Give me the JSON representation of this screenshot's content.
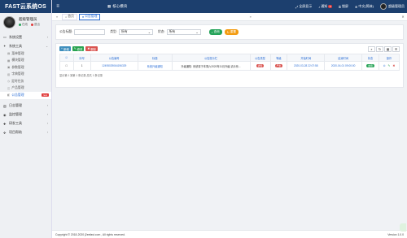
{
  "brand": "FAST云系统OS",
  "user": {
    "name": "超级管理员",
    "status_online": "在线",
    "status_logout": "退出"
  },
  "sidebar": {
    "items": [
      {
        "label": "系统设置",
        "icon": "monitor-icon"
      },
      {
        "label": "系统工具",
        "icon": "tools-icon",
        "expanded": true,
        "children": [
          {
            "label": "菜单管理"
          },
          {
            "label": "模块管理"
          },
          {
            "label": "参数管理"
          },
          {
            "label": "字典管理"
          },
          {
            "label": "定时任务"
          },
          {
            "label": "产品管理"
          },
          {
            "label": "公告管理",
            "active": true,
            "badge": "new"
          }
        ]
      },
      {
        "label": "日志管理",
        "icon": "log-icon"
      },
      {
        "label": "监控管理",
        "icon": "monitor-gear-icon"
      },
      {
        "label": "研发工具",
        "icon": "wrench-icon"
      },
      {
        "label": "项目帮助",
        "icon": "help-icon"
      }
    ]
  },
  "topbar": {
    "menu_toggle": "≡",
    "home": "核心模块",
    "fullscreen": "全屏显示",
    "notify": "通知",
    "notify_count": "8",
    "lock": "锁屏",
    "lang": "中文(简体)",
    "user": "超级管理员"
  },
  "tabs": {
    "home": "首页",
    "current": "公告管理"
  },
  "filters": {
    "title_label": "公告标题:",
    "type_label": "类型:",
    "type_value": "所有",
    "status_label": "状态:",
    "status_value": "所有",
    "search_button": "查询",
    "reset_button": "重置"
  },
  "toolbar": {
    "add": "新增",
    "edit": "修改",
    "delete": "删除"
  },
  "table": {
    "headers": [
      "序号",
      "公告编号",
      "标题",
      "公告提示栏",
      "公告类型",
      "等级",
      "开始时间",
      "结束时间",
      "状态",
      "操作"
    ],
    "rows": [
      {
        "index": "1",
        "number": "12495029064196329",
        "title": "系统升级通知",
        "notice": "升级通知: 系统将于本周六2020年11月升级,请示系...",
        "type": "通知",
        "level": "严重",
        "start": "2020-03-28 22:07:58",
        "end": "2020-04-01 09:00:00",
        "status": "启用"
      }
    ],
    "pager": "显示第 1 到第 1 条记录,总共 1 条记录"
  },
  "footer": {
    "copyright": "Copyright © 2018-2020 j2eefast.com , All rights reserved.",
    "version": "Version 1.0.0"
  },
  "colors": {
    "topbar": "#1c3f6e",
    "accent": "#2c6fd6",
    "search": "#25a35a",
    "reset": "#f39c12",
    "danger": "#d9534f"
  }
}
